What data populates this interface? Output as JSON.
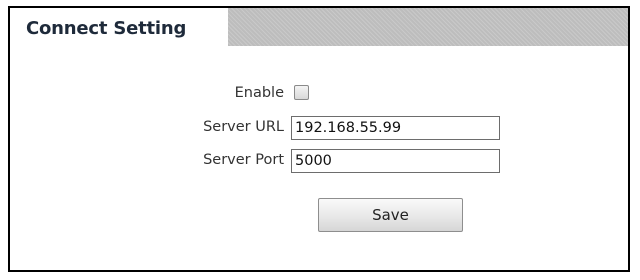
{
  "panel": {
    "title": "Connect Setting"
  },
  "form": {
    "enable_label": "Enable",
    "enable_checked": false,
    "server_url_label": "Server URL",
    "server_url_value": "192.168.55.99",
    "server_port_label": "Server Port",
    "server_port_value": "5000",
    "save_label": "Save"
  }
}
